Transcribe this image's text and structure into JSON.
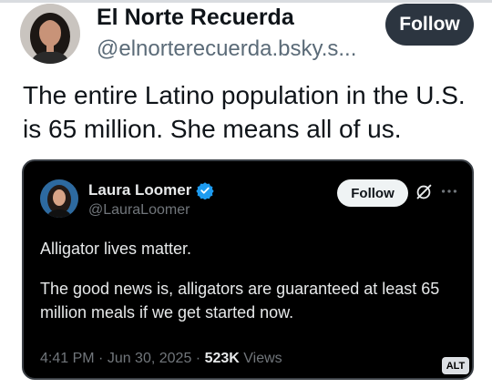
{
  "post": {
    "author_name": "El Norte Recuerda",
    "author_handle": "@elnorterecuerda.bsky.s...",
    "follow_label": "Follow",
    "text": "The entire Latino population in the U.S. is 65 million. She means all of us."
  },
  "quoted_post": {
    "author_name": "Laura Loomer",
    "author_handle": "@LauraLoomer",
    "follow_label": "Follow",
    "paragraph_1": "Alligator lives matter.",
    "paragraph_2": "The good news is, alligators are guaranteed at least 65 million meals if we get started now.",
    "time": "4:41 PM",
    "date": "Jun 30, 2025",
    "views_count": "523K",
    "views_label": "Views",
    "alt_badge": "ALT",
    "icons": [
      "verified-badge-icon",
      "grok-icon",
      "more-options-icon"
    ]
  },
  "colors": {
    "follow_button_bg": "#2c3540",
    "verified_blue": "#1d9bf0",
    "embed_bg": "#000000"
  }
}
